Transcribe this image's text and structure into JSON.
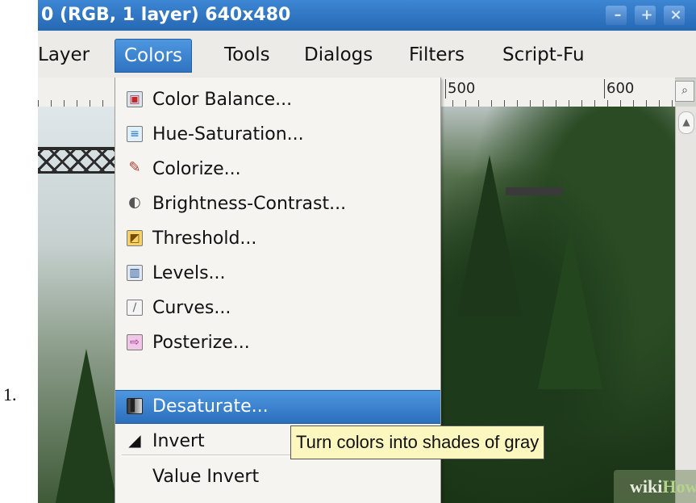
{
  "step_number": "1.",
  "window": {
    "title": "0 (RGB, 1 layer) 640x480",
    "buttons": {
      "minimize": "–",
      "maximize": "+",
      "close": "×"
    }
  },
  "menubar": {
    "items": [
      {
        "label": "Layer",
        "state": "normal"
      },
      {
        "label": "Colors",
        "state": "open"
      },
      {
        "label": "Tools",
        "state": "normal"
      },
      {
        "label": "Dialogs",
        "state": "normal"
      },
      {
        "label": "Filters",
        "state": "normal"
      },
      {
        "label": "Script-Fu",
        "state": "normal"
      }
    ]
  },
  "ruler": {
    "labels": [
      "500",
      "600"
    ]
  },
  "colors_menu": {
    "items": [
      {
        "label": "Color Balance...",
        "icon": "color-balance-icon",
        "glyph": "▣"
      },
      {
        "label": "Hue-Saturation...",
        "icon": "hue-saturation-icon",
        "glyph": "≡"
      },
      {
        "label": "Colorize...",
        "icon": "colorize-icon",
        "glyph": "✎"
      },
      {
        "label": "Brightness-Contrast...",
        "icon": "brightness-contrast-icon",
        "glyph": "◐"
      },
      {
        "label": "Threshold...",
        "icon": "threshold-icon",
        "glyph": "◩"
      },
      {
        "label": "Levels...",
        "icon": "levels-icon",
        "glyph": "▥"
      },
      {
        "label": "Curves...",
        "icon": "curves-icon",
        "glyph": "∕"
      },
      {
        "label": "Posterize...",
        "icon": "posterize-icon",
        "glyph": "⇨"
      },
      {
        "label": "Desaturate...",
        "icon": "desaturate-icon",
        "glyph": "▌",
        "highlighted": true
      },
      {
        "label": "Invert",
        "icon": "invert-icon",
        "glyph": "◢"
      },
      {
        "label": "Value Invert",
        "icon": "",
        "glyph": ""
      }
    ]
  },
  "tooltip": {
    "text": "Turn colors into shades of gray"
  },
  "watermark": {
    "part1": "wiki",
    "part2": "How"
  },
  "colors": {
    "title_bar": "#2f74c0",
    "highlight": "#3a82d0",
    "tooltip_bg": "#fbf7bf"
  }
}
